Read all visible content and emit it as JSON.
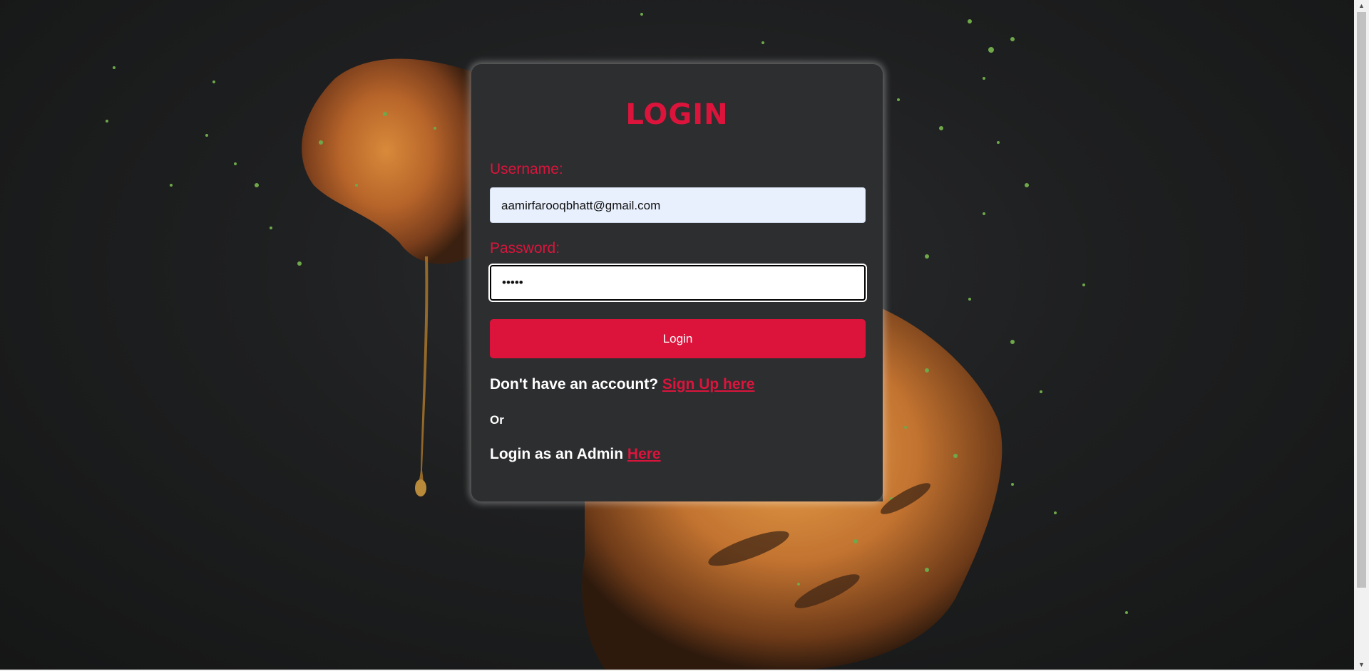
{
  "login": {
    "title": "LOGIN",
    "username_label": "Username:",
    "username_value": "aamirfarooqbhatt@gmail.com",
    "password_label": "Password:",
    "password_value": "•••••",
    "login_button": "Login",
    "signup_prompt": "Don't have an account?",
    "signup_link": "Sign Up here",
    "or_text": "Or",
    "admin_prompt": "Login as an Admin",
    "admin_link": "Here"
  },
  "colors": {
    "accent": "#dc143c",
    "card": "#2d2e30",
    "background": "#1b1c1d",
    "username_fill": "#e8f0fe"
  },
  "background": {
    "image": "roasted-chicken-food-photo"
  },
  "icons": {
    "scroll_up": "scroll-up-arrow-icon",
    "scroll_down": "scroll-down-arrow-icon"
  }
}
